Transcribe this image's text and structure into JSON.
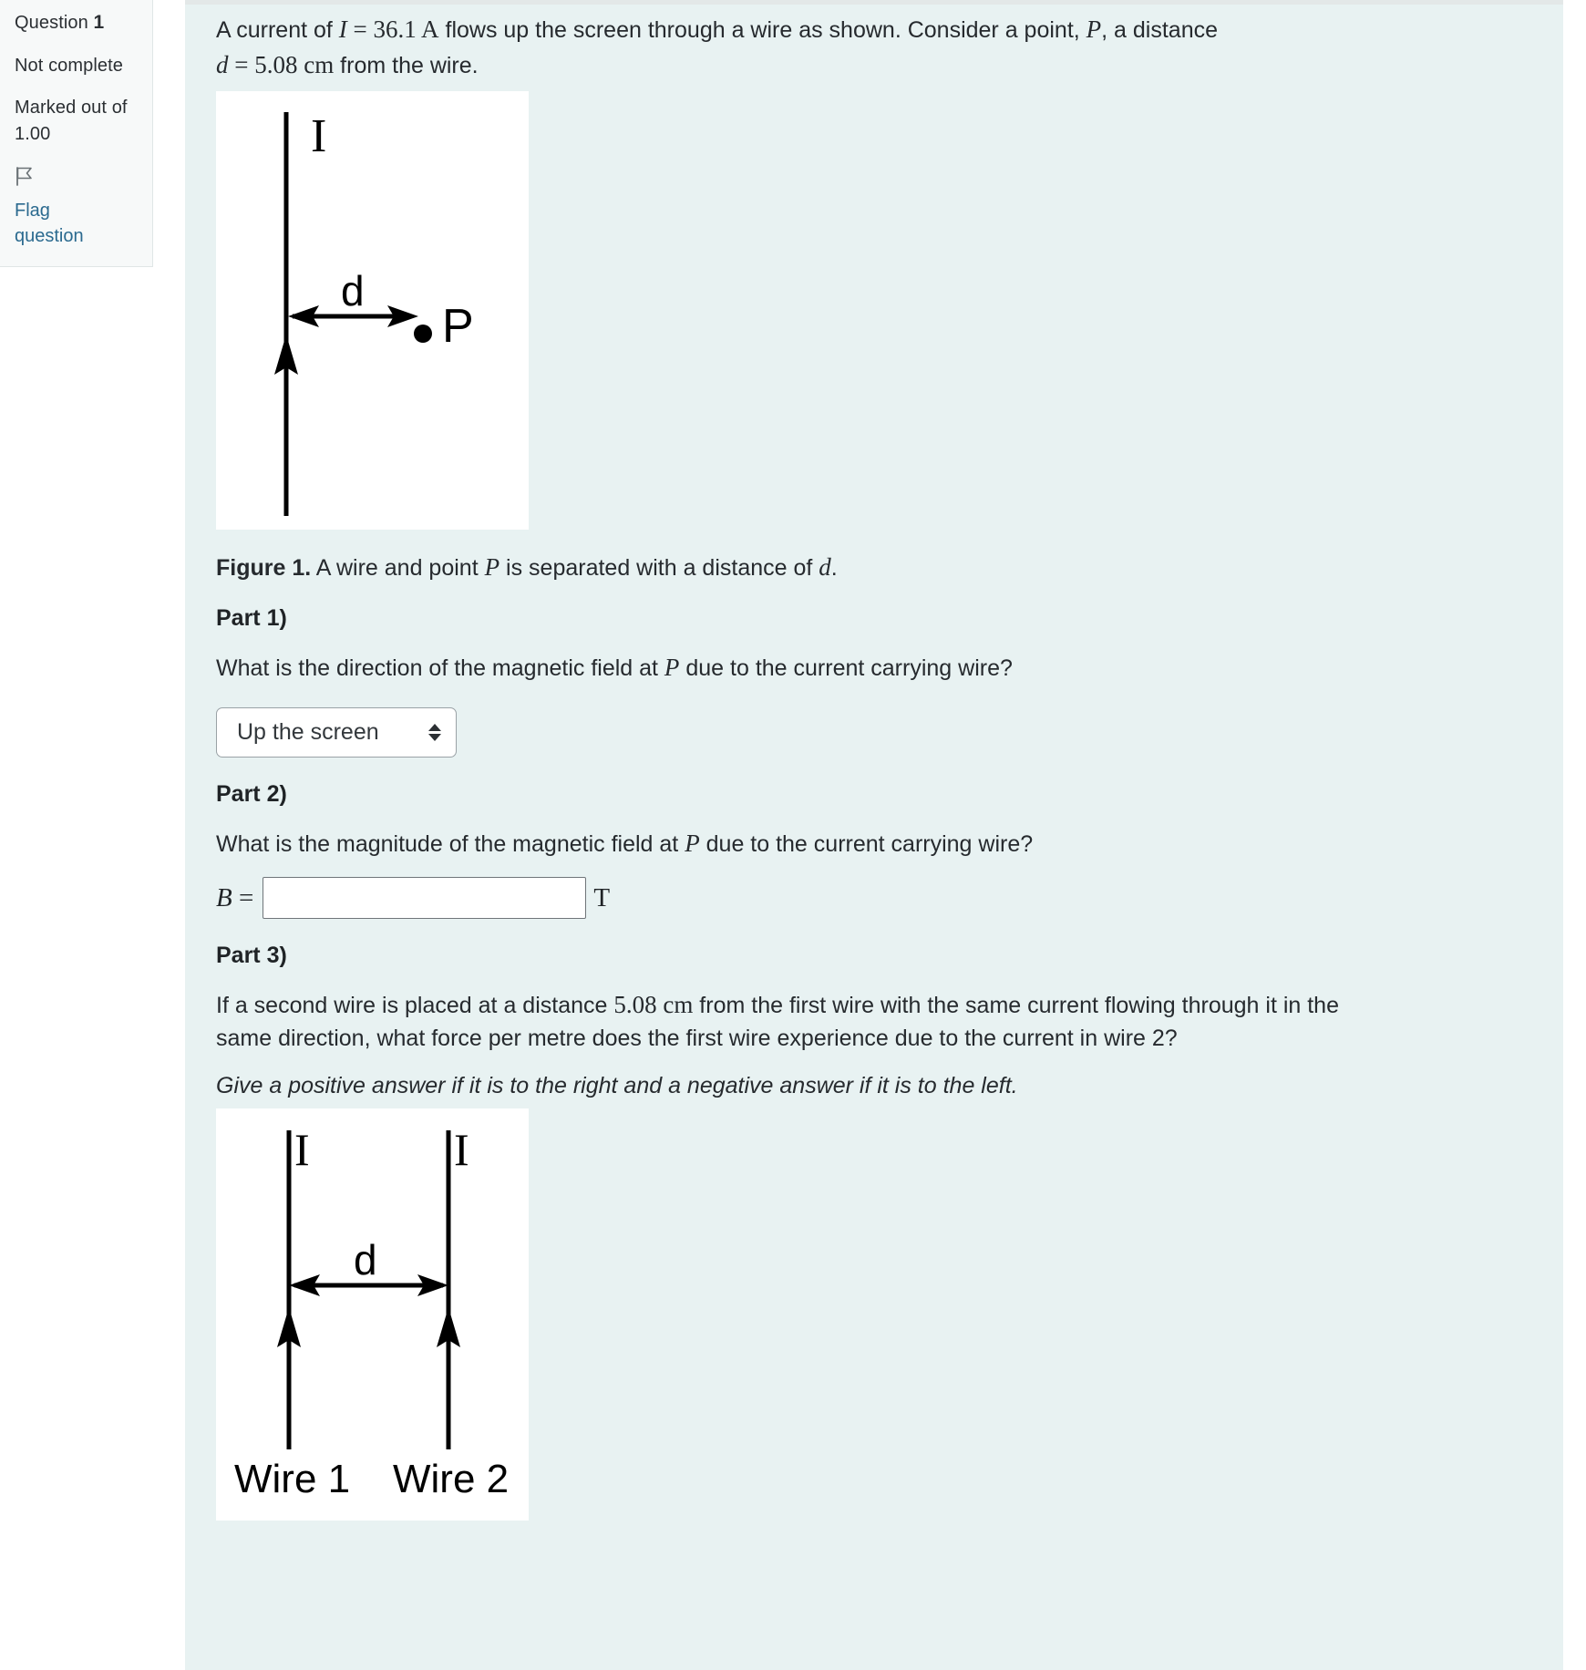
{
  "sidebar": {
    "question_label": "Question",
    "question_number": "1",
    "status": "Not complete",
    "marks_label": "Marked out of",
    "marks_value": "1.00",
    "flag_label_line1": "Flag",
    "flag_label_line2": "question",
    "flag_icon": "flag-icon"
  },
  "question": {
    "intro_a": "A current of ",
    "intro_I": "I",
    "intro_eq": " = ",
    "intro_current": "36.1",
    "intro_unit": " A",
    "intro_b": " flows up the screen through a wire as shown. Consider a point, ",
    "intro_P": "P",
    "intro_c": ", a distance",
    "intro_d": "d",
    "intro_d_eq": " = ",
    "intro_distance": "5.08",
    "intro_distance_unit": " cm",
    "intro_e": " from the wire."
  },
  "figure1": {
    "current_label": "I",
    "distance_label": "d",
    "point_label": "P",
    "caption_bold": "Figure 1.",
    "caption_a": " A wire and point ",
    "caption_P": "P",
    "caption_b": " is separated with a distance of ",
    "caption_d": "d",
    "caption_c": "."
  },
  "part1": {
    "heading": "Part 1)",
    "prompt_a": "What is the direction of the magnetic field at ",
    "prompt_P": "P",
    "prompt_b": " due to the current carrying wire?",
    "select_value": "Up the screen",
    "select_options": [
      "Up the screen"
    ]
  },
  "part2": {
    "heading": "Part 2)",
    "prompt_a": "What is the magnitude of the magnetic field at ",
    "prompt_P": "P",
    "prompt_b": " due to the current carrying wire?",
    "field_label_var": "B",
    "field_label_eq": " =",
    "field_value": "",
    "field_placeholder": "",
    "unit": "T"
  },
  "part3": {
    "heading": "Part 3)",
    "prompt_a": "If a second wire is placed at a distance ",
    "prompt_distance": "5.08",
    "prompt_distance_unit": " cm",
    "prompt_b": " from the first wire with the same current flowing through it in the same direction, what force per metre does the first wire experience due to the current in wire 2?",
    "note": "Give a positive answer if it is to the right and a negative answer if it is to the left."
  },
  "figure2": {
    "current_label_1": "I",
    "current_label_2": "I",
    "distance_label": "d",
    "wire1_label": "Wire 1",
    "wire2_label": "Wire 2"
  },
  "colors": {
    "content_background": "#e8f2f2",
    "sidebar_background": "#f7f9f9",
    "link": "#2b6a8f",
    "text": "#262a2e"
  }
}
